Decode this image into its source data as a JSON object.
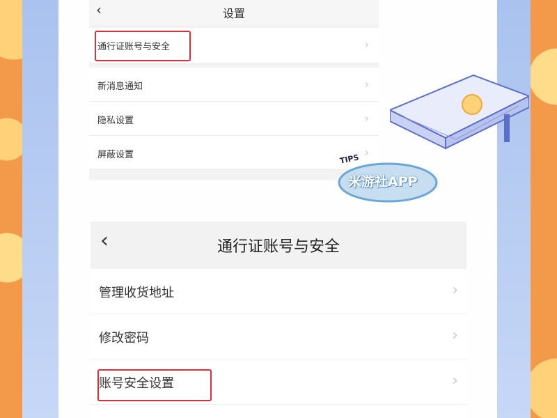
{
  "top_screen": {
    "title": "设置",
    "back_icon": "chevron-left-icon",
    "items": [
      {
        "label": "通行证账号与安全"
      },
      {
        "label": "新消息通知"
      },
      {
        "label": "隐私设置"
      },
      {
        "label": "屏蔽设置"
      }
    ]
  },
  "tips_badge": {
    "tag": "TIPS",
    "text": "米游社APP"
  },
  "bottom_screen": {
    "title": "通行证账号与安全",
    "back_icon": "chevron-left-icon",
    "items": [
      {
        "label": "管理收货地址"
      },
      {
        "label": "修改密码"
      },
      {
        "label": "账号安全设置"
      }
    ]
  },
  "colors": {
    "highlight": "#d6303a",
    "orange_bg": "#f29a4a",
    "blue_panel": "#b7cbf2"
  }
}
